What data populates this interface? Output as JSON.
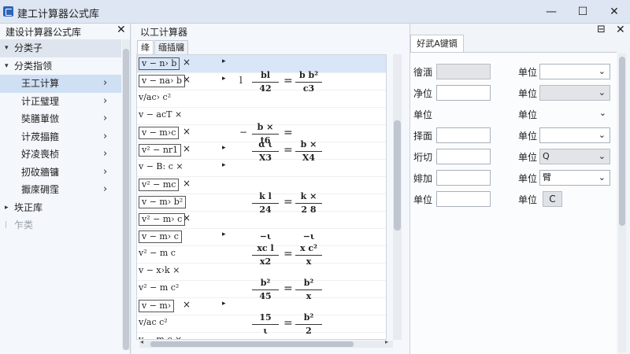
{
  "window": {
    "title": "建工计算器公式库",
    "minimize_glyph": "—",
    "maximize_glyph": "☐",
    "close_glyph": "✕"
  },
  "left_panel": {
    "title": "建设计算器公式库",
    "close_glyph": "✕",
    "tree": [
      {
        "label": "分类子",
        "level": 0,
        "expanded": true,
        "state": "top-selected"
      },
      {
        "label": "分类指领",
        "level": 0,
        "expanded": true
      },
      {
        "label": "王工计算",
        "level": 1,
        "selected": true
      },
      {
        "label": "计正璧理",
        "level": 1
      },
      {
        "label": "奘膳莗倣",
        "level": 1
      },
      {
        "label": "计荗揊箍",
        "level": 1
      },
      {
        "label": "好凌喪桢",
        "level": 1
      },
      {
        "label": "扨砇牆镛",
        "level": 1
      },
      {
        "label": "擫庲砽霔",
        "level": 1
      },
      {
        "label": "垁正库",
        "level": 0,
        "expanded": false
      },
      {
        "label": "乍类",
        "level": 0,
        "dim": true
      }
    ]
  },
  "middle_panel": {
    "title": "以工计算器",
    "tabs": [
      "绛",
      "缅插牖"
    ],
    "formulas": [
      {
        "a": "v − n› b",
        "boxed": true,
        "b": "×",
        "c": "▸",
        "d": "",
        "l": "",
        "r": "",
        "highlight": true
      },
      {
        "a": "v − na› b",
        "boxed": true,
        "b": "×",
        "c": "▸",
        "d": "l",
        "l": [
          "bl",
          "42"
        ],
        "r": [
          "b b²",
          "c3"
        ]
      },
      {
        "a": "v/ac› c²",
        "boxed": false,
        "b": "",
        "c": "",
        "d": "",
        "l": "",
        "r": ""
      },
      {
        "a": "v − acT ×",
        "boxed": false,
        "b": "",
        "c": "",
        "d": "",
        "l": "",
        "r": ""
      },
      {
        "a": "v − m›c",
        "boxed": true,
        "b": "×",
        "c": "",
        "d": "−",
        "l": [
          "b ×",
          "t6"
        ],
        "r": ""
      },
      {
        "a": "v² − nr1",
        "boxed": true,
        "b": "×",
        "c": "▸",
        "d": "",
        "l": [
          "α  ι",
          "X3"
        ],
        "r": [
          "b ×",
          "X4"
        ]
      },
      {
        "a": "v − B: c ×",
        "boxed": false,
        "b": "",
        "c": "▸",
        "d": "",
        "l": "",
        "r": ""
      },
      {
        "a": "v² − mc",
        "boxed": true,
        "b": "×",
        "c": "",
        "d": "",
        "l": "",
        "r": ""
      },
      {
        "a": "v − m› b²",
        "boxed": true,
        "b": "",
        "c": "",
        "d": "",
        "l": [
          "k l",
          "24"
        ],
        "r": [
          "k ×",
          "2 8"
        ]
      },
      {
        "a": "v² − m› c",
        "boxed": true,
        "b": "×",
        "c": "",
        "d": "",
        "l": "",
        "r": ""
      },
      {
        "a": "v − m› c",
        "boxed": true,
        "b": "",
        "c": "▸",
        "d": "",
        "l": "−ι",
        "r": "−ι"
      },
      {
        "a": "v² − m c",
        "boxed": false,
        "b": "",
        "c": "",
        "d": "",
        "l": [
          "xc l",
          "x2"
        ],
        "r": [
          "x c²",
          "x"
        ]
      },
      {
        "a": "v − x›k ×",
        "boxed": false,
        "b": "",
        "c": "",
        "d": "",
        "l": "",
        "r": ""
      },
      {
        "a": "v² − m c²",
        "boxed": false,
        "b": "",
        "c": "",
        "d": "",
        "l": [
          "b²",
          "45"
        ],
        "r": [
          "b²",
          "x"
        ]
      },
      {
        "a": "v − m›",
        "boxed": true,
        "b": "×",
        "c": "▸",
        "d": "",
        "l": "",
        "r": ""
      },
      {
        "a": "v/ac c²",
        "boxed": false,
        "b": "",
        "c": "",
        "d": "",
        "l": [
          "15",
          "ι"
        ],
        "r": [
          "b²",
          "2"
        ]
      },
      {
        "a": "v − m c ×",
        "boxed": false,
        "b": "",
        "c": "",
        "d": "",
        "l": "",
        "r": ""
      }
    ]
  },
  "right_panel": {
    "tab_label": "好武A键镉",
    "pin_glyph": "⊟",
    "close_glyph": "✕",
    "fields": [
      {
        "label": "徻湎",
        "input": "",
        "input_style": "gray",
        "unit_label": "单位",
        "select": "",
        "select_style": "white"
      },
      {
        "label": "净位",
        "input": "",
        "input_style": "white",
        "unit_label": "单位",
        "select": "",
        "select_style": "gray"
      },
      {
        "label": "单位",
        "input": null,
        "unit_label": "单位",
        "select": "",
        "select_style": "chev-only"
      },
      {
        "label": "择面",
        "input": "",
        "input_style": "white",
        "unit_label": "单位",
        "select": "",
        "select_style": "white"
      },
      {
        "label": "垳切",
        "input": "",
        "input_style": "white",
        "unit_label": "单位",
        "select": "Q",
        "select_style": "gray"
      },
      {
        "label": "婔加",
        "input": "",
        "input_style": "white",
        "unit_label": "单位",
        "select": "臂",
        "select_style": "white"
      },
      {
        "label": "单位",
        "input": "",
        "input_style": "white",
        "unit_label": "单位",
        "button": "C"
      }
    ]
  },
  "colors": {
    "selection": "#cfdff4",
    "highlight_row": "#d8e6f8",
    "titlebar": "#dde6f2",
    "accent": "#2e64b8"
  }
}
